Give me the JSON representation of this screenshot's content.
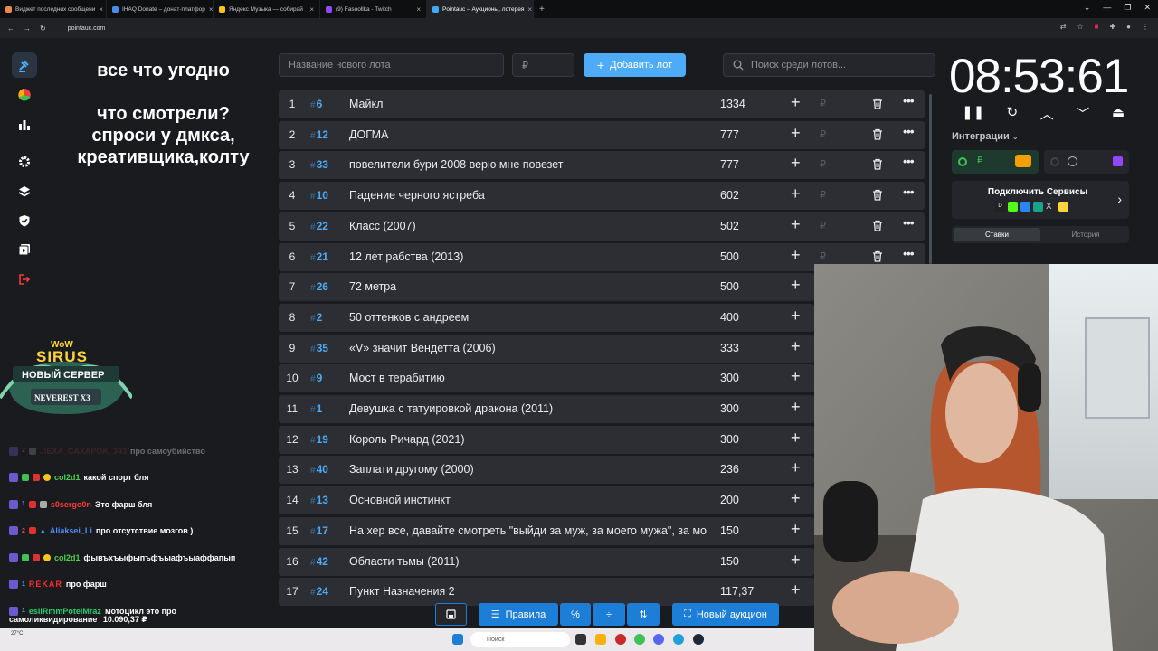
{
  "browser": {
    "tabs": [
      {
        "title": "Виджет последних сообщени",
        "color": "#e8884a"
      },
      {
        "title": "IHAQ Donate – донат-платфор",
        "color": "#4a8be8"
      },
      {
        "title": "Яндекс Музыка — собирай",
        "color": "#f5c518"
      },
      {
        "title": "(9) Fasoollka - Twitch",
        "color": "#9146ff"
      },
      {
        "title": "Pointauc – Аукционы, лотерея",
        "color": "#3fa9f5"
      }
    ],
    "url": "pointauc.com"
  },
  "overlay": {
    "topic_lines": [
      "все что угодно",
      "",
      "что смотрели?",
      "спроси у дмкса,",
      "креативщика,колту"
    ],
    "sirus": {
      "top": "WoW",
      "brand": "SIRUS",
      "title": "НОВЫЙ СЕРВЕР",
      "server": "NEVEREST X3"
    }
  },
  "chat": {
    "messages": [
      {
        "count": "2",
        "user": "JIEXA_CAXAPOK_343",
        "user_color": "#7a3030",
        "text": "про самоубийство",
        "faded": true
      },
      {
        "count": "",
        "user": "col2d1",
        "user_color": "#4dd04d",
        "text": "какой спорт бля",
        "faded": false
      },
      {
        "count": "1",
        "user": "s0sergo0n",
        "user_color": "#ff3b3b",
        "text": "Это фарш бля",
        "faded": false
      },
      {
        "count": "2",
        "user": "Aliaksei_Li",
        "user_color": "#4e8cff",
        "text": "про отсутствие мозгов )",
        "faded": false
      },
      {
        "count": "",
        "user": "col2d1",
        "user_color": "#4dd04d",
        "text": "фывъхъыфыпъфъыафъыаффапып",
        "faded": false
      },
      {
        "count": "1",
        "user": "REKAR",
        "user_color": "#ff2d2d",
        "text": "про фарш",
        "faded": false
      },
      {
        "count": "1",
        "user": "esliRmmPoteiMraz",
        "user_color": "#2ecc71",
        "text": "мотоцикл это про",
        "faded": false
      }
    ],
    "overflow_text": "самоликвидирование",
    "donation_amount": "10.090,37 ₽"
  },
  "form": {
    "name_placeholder": "Название нового лота",
    "amount_placeholder": "₽",
    "add_label": "Добавить лот",
    "search_placeholder": "Поиск среди лотов..."
  },
  "lots": [
    {
      "idx": "1",
      "num": "6",
      "name": "Майкл",
      "amount": "1334"
    },
    {
      "idx": "2",
      "num": "12",
      "name": "ДОГМА",
      "amount": "777"
    },
    {
      "idx": "3",
      "num": "33",
      "name": "повелители бури 2008 верю мне повезет",
      "amount": "777"
    },
    {
      "idx": "4",
      "num": "10",
      "name": "Падение черного ястреба",
      "amount": "602"
    },
    {
      "idx": "5",
      "num": "22",
      "name": "Класс (2007)",
      "amount": "502"
    },
    {
      "idx": "6",
      "num": "21",
      "name": "12 лет рабства (2013)",
      "amount": "500"
    },
    {
      "idx": "7",
      "num": "26",
      "name": "72 метра",
      "amount": "500"
    },
    {
      "idx": "8",
      "num": "2",
      "name": "50 оттенков с андреем",
      "amount": "400"
    },
    {
      "idx": "9",
      "num": "35",
      "name": "«V» значит Вендетта (2006)",
      "amount": "333"
    },
    {
      "idx": "10",
      "num": "9",
      "name": "Мост в терабитию",
      "amount": "300"
    },
    {
      "idx": "11",
      "num": "1",
      "name": "Девушка с татуировкой дракона (2011)",
      "amount": "300"
    },
    {
      "idx": "12",
      "num": "19",
      "name": "Король Ричард (2021)",
      "amount": "300"
    },
    {
      "idx": "13",
      "num": "40",
      "name": "Заплати другому (2000)",
      "amount": "236"
    },
    {
      "idx": "14",
      "num": "13",
      "name": "Основной инстинкт",
      "amount": "200"
    },
    {
      "idx": "15",
      "num": "17",
      "name": "На хер все, давайте смотреть \"выйди за муж, за моего мужа\", за моего",
      "amount": "150"
    },
    {
      "idx": "16",
      "num": "42",
      "name": "Области тьмы (2011)",
      "amount": "150"
    },
    {
      "idx": "17",
      "num": "24",
      "name": "Пункт Назначения 2",
      "amount": "117,37"
    }
  ],
  "bottom": {
    "rules_label": "Правила",
    "new_auction_label": "Новый аукцион"
  },
  "timer": {
    "value": "08:53:61"
  },
  "integrations": {
    "label": "Интеграции",
    "connect_label": "Подключить Сервисы",
    "tab_bids": "Ставки",
    "tab_history": "История"
  },
  "taskbar": {
    "temp": "27°C",
    "search_placeholder": "Поиск"
  },
  "colors": {
    "accent": "#4dabf7",
    "accent_dark": "#1c7ed6",
    "row_bg": "#2c2e33",
    "page_bg": "#1a1b1e"
  }
}
